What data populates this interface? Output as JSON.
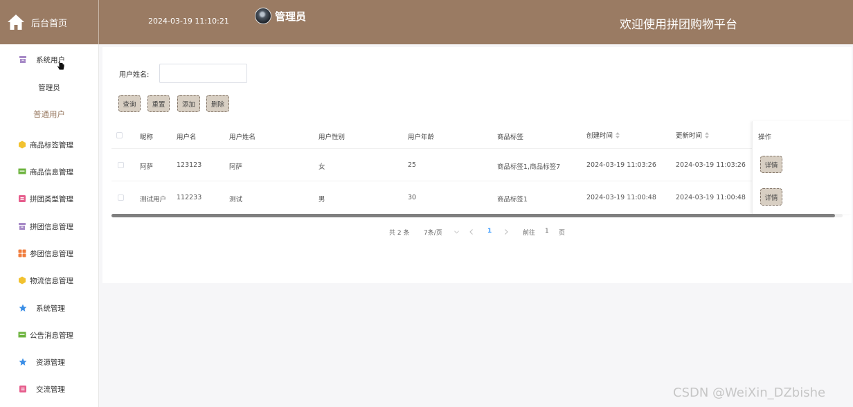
{
  "header": {
    "brand_label": "后台首页",
    "datetime": "2024-03-19 11:10:21",
    "role": "管理员",
    "welcome": "欢迎使用拼团购物平台"
  },
  "sidebar": {
    "items": [
      {
        "label": "系统用户",
        "icon": "archive-icon",
        "color": "#a78ac7"
      },
      {
        "label": "商品标签管理",
        "icon": "hexagon-icon",
        "color": "#f2c230"
      },
      {
        "label": "商品信息管理",
        "icon": "message-icon",
        "color": "#6cb33e"
      },
      {
        "label": "拼团类型管理",
        "icon": "bag-icon",
        "color": "#e65d8c"
      },
      {
        "label": "拼团信息管理",
        "icon": "archive-icon",
        "color": "#a78ac7"
      },
      {
        "label": "参团信息管理",
        "icon": "grid-icon",
        "color": "#f07c3c"
      },
      {
        "label": "物流信息管理",
        "icon": "hexagon-icon",
        "color": "#f2c230"
      },
      {
        "label": "系统管理",
        "icon": "star-icon",
        "color": "#3a8ee6"
      },
      {
        "label": "公告消息管理",
        "icon": "message-icon",
        "color": "#6cb33e"
      },
      {
        "label": "资源管理",
        "icon": "star-icon",
        "color": "#3a8ee6"
      },
      {
        "label": "交流管理",
        "icon": "bag-icon",
        "color": "#e65d8c"
      }
    ],
    "submenu": [
      {
        "label": "管理员"
      },
      {
        "label": "普通用户"
      }
    ]
  },
  "search": {
    "label": "用户姓名:",
    "value": "",
    "placeholder": ""
  },
  "buttons": {
    "query": "查询",
    "reset": "重置",
    "add": "添加",
    "delete": "删除"
  },
  "table": {
    "headers": {
      "nickname": "昵称",
      "username": "用户名",
      "realname": "用户姓名",
      "gender": "用户性别",
      "age": "用户年龄",
      "tags": "商品标签",
      "created": "创建时间",
      "updated": "更新时间",
      "ops": "操作"
    },
    "rows": [
      {
        "nickname": "阿萨",
        "username": "123123",
        "realname": "阿萨",
        "gender": "女",
        "age": "25",
        "tags": "商品标签1,商品标签7",
        "created": "2024-03-19 11:03:26",
        "updated": "2024-03-19 11:03:26",
        "op": "详情"
      },
      {
        "nickname": "测试用户",
        "username": "112233",
        "realname": "测试",
        "gender": "男",
        "age": "30",
        "tags": "商品标签1",
        "created": "2024-03-19 11:00:48",
        "updated": "2024-03-19 11:00:48",
        "op": "详情"
      }
    ]
  },
  "pagination": {
    "total": "共 2 条",
    "page_size": "7条/页",
    "current": "1",
    "goto_label": "前往",
    "goto_value": "1",
    "page_suffix": "页"
  },
  "watermark": "CSDN @WeiXin_DZbishe",
  "colors": {
    "header": "#9a7b63",
    "button": "#d8cfc3",
    "active": "#9a7b63",
    "pager_active": "#409eff"
  }
}
